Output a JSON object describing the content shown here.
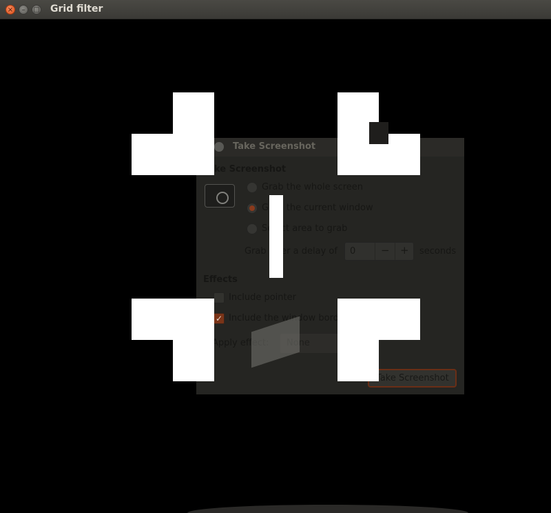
{
  "window": {
    "title": "Grid filter",
    "close_glyph": "×",
    "min_glyph": "–",
    "max_glyph": "□"
  },
  "dialog": {
    "title": "Take Screenshot",
    "section_capture": "Take Screenshot",
    "options": [
      "Grab the whole screen",
      "Grab the current window",
      "Select area to grab"
    ],
    "selected_option": "Grab the current window",
    "delay_prefix": "Grab after a delay of",
    "delay_value": "0",
    "delay_suffix": "seconds",
    "minus": "−",
    "plus": "+",
    "section_effects": "Effects",
    "include_pointer": "Include pointer",
    "include_border": "Include the window border",
    "apply_effect_label": "Apply effect:",
    "apply_effect_value": "None",
    "take_button": "Take Screenshot"
  },
  "icons": [
    "close-icon",
    "minimize-icon",
    "maximize-icon",
    "camera-icon",
    "dropdown-arrow-icon"
  ],
  "colors": {
    "accent": "#e0541e",
    "background": "#000000",
    "cross": "#ffffff"
  }
}
